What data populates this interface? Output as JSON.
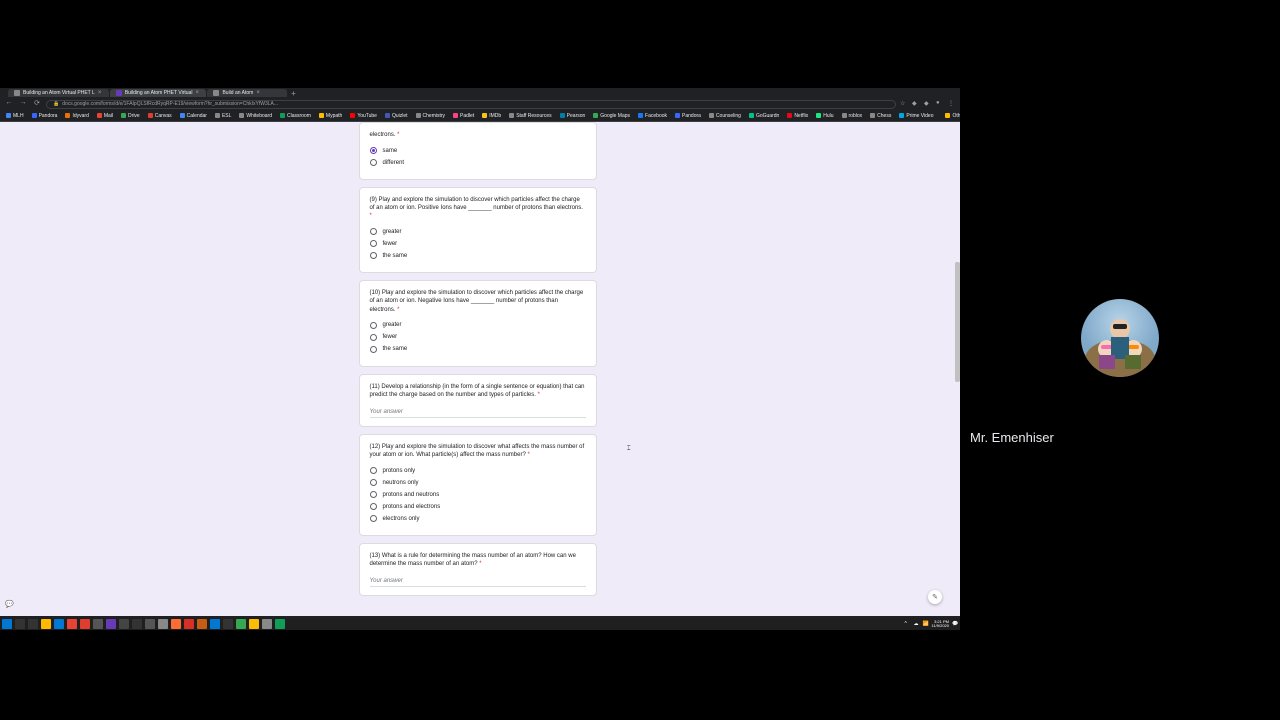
{
  "tabs": [
    {
      "label": "Building an Atom Virtual PHET L",
      "active": false
    },
    {
      "label": "Building an Atom PHET Virtual",
      "active": true
    },
    {
      "label": "Build an Atom",
      "active": false
    }
  ],
  "url": "docs.google.com/forms/d/e/1FAIpQLSfRcdRyqRP-E19/viewform?hr_submission=ChkIxYfW3LA...",
  "bookmarks": [
    {
      "label": "MLH",
      "color": "#4285f4"
    },
    {
      "label": "Pandora",
      "color": "#3668ff"
    },
    {
      "label": "Idyvard",
      "color": "#e8710a"
    },
    {
      "label": "Mail",
      "color": "#ea4335"
    },
    {
      "label": "Drive",
      "color": "#34a853"
    },
    {
      "label": "Canvas",
      "color": "#e03e2d"
    },
    {
      "label": "Calendar",
      "color": "#4285f4"
    },
    {
      "label": "ESL",
      "color": "#888"
    },
    {
      "label": "Whiteboard",
      "color": "#888"
    },
    {
      "label": "Classroom",
      "color": "#0f9d58"
    },
    {
      "label": "Mypath",
      "color": "#fbbc04"
    },
    {
      "label": "YouTube",
      "color": "#ff0000"
    },
    {
      "label": "Quizlet",
      "color": "#4257b2"
    },
    {
      "label": "Chemistry",
      "color": "#888"
    },
    {
      "label": "Padlet",
      "color": "#ff4081"
    },
    {
      "label": "IMDb",
      "color": "#f5c518"
    },
    {
      "label": "Staff Resources",
      "color": "#888"
    },
    {
      "label": "Pearson",
      "color": "#007fa3"
    },
    {
      "label": "Google Maps",
      "color": "#34a853"
    },
    {
      "label": "Facebook",
      "color": "#1877f2"
    },
    {
      "label": "Pandora",
      "color": "#3668ff"
    },
    {
      "label": "Counseling",
      "color": "#888"
    },
    {
      "label": "GoGuardn",
      "color": "#00c389"
    },
    {
      "label": "Netflix",
      "color": "#e50914"
    },
    {
      "label": "Hulu",
      "color": "#1ce783"
    },
    {
      "label": "roblox",
      "color": "#888"
    },
    {
      "label": "Chess",
      "color": "#888"
    },
    {
      "label": "Prime Video",
      "color": "#00a8e1"
    }
  ],
  "other_bookmarks": "Other bookmarks",
  "questions": {
    "q8_partial": {
      "text_end": "electrons.",
      "options": [
        "same",
        "different"
      ],
      "selected": 0
    },
    "q9": {
      "text": "(9) Play and explore the simulation to discover which particles affect the charge of an atom or ion. Positive Ions have _______ number of protons than electrons.",
      "options": [
        "greater",
        "fewer",
        "the same"
      ]
    },
    "q10": {
      "text": "(10) Play and explore the simulation to discover which particles affect the charge of an atom or ion. Negative Ions have _______ number of protons than electrons.",
      "options": [
        "greater",
        "fewer",
        "the same"
      ]
    },
    "q11": {
      "text": "(11) Develop a relationship (in the form of a single sentence or equation) that can predict the charge based on the number and types of particles.",
      "placeholder": "Your answer"
    },
    "q12": {
      "text": "(12) Play and explore the simulation to discover what affects the mass number of your atom or ion. What particle(s) affect the mass number?",
      "options": [
        "protons only",
        "neutrons only",
        "protons and neutrons",
        "protons and electrons",
        "electrons only"
      ]
    },
    "q13": {
      "text": "(13) What is a rule for determining the mass number of an atom? How can we determine the mass number of an atom?",
      "placeholder": "Your answer"
    }
  },
  "required_marker": " *",
  "tray": {
    "time": "3:21 PM",
    "date": "11/9/2020"
  },
  "presenter": "Mr. Emenhiser"
}
